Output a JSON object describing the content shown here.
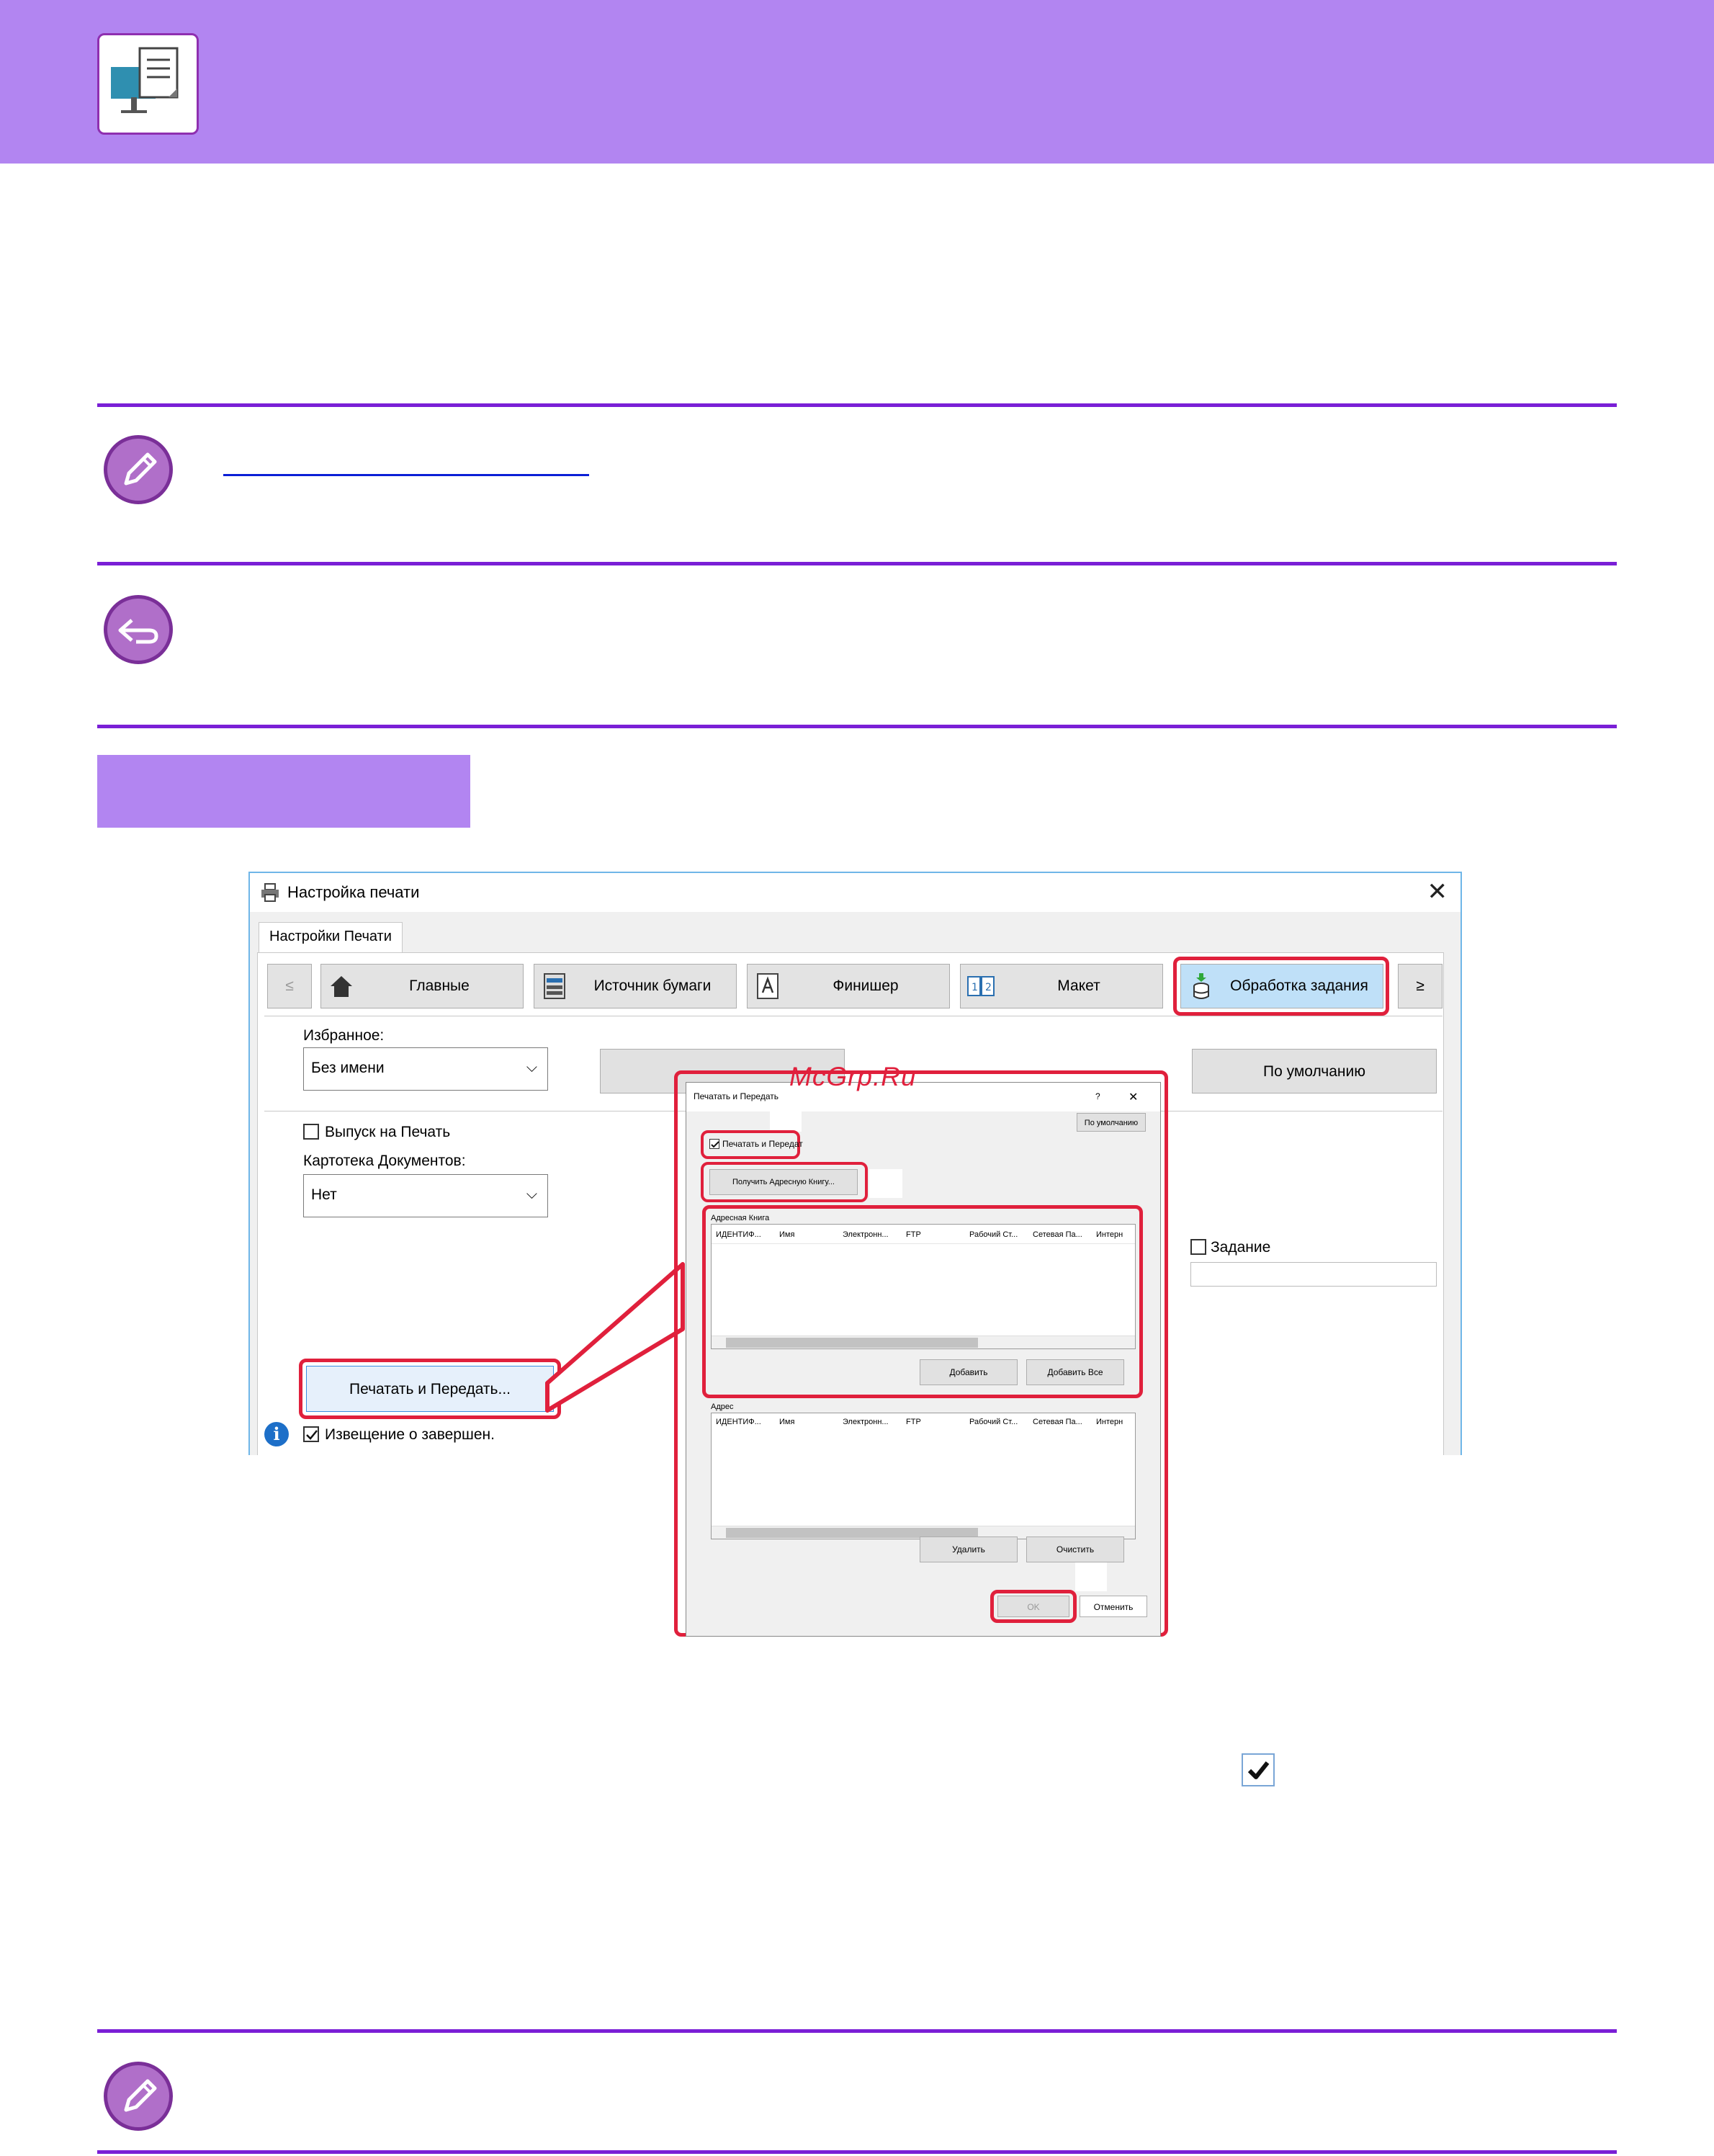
{
  "header": {
    "logo_icon": "print-to-screen-icon"
  },
  "notes": {
    "note_icon": "pencil-icon",
    "back_icon": "return-icon"
  },
  "window": {
    "title": "Настройка печати",
    "tab_label": "Настройки Печати",
    "nav_prev": "≤",
    "nav_next": "≥",
    "tabs": [
      {
        "label": "Главные",
        "icon": "home-icon"
      },
      {
        "label": "Источник бумаги",
        "icon": "paper-tray-icon"
      },
      {
        "label": "Финишер",
        "icon": "finisher-icon"
      },
      {
        "label": "Макет",
        "icon": "layout-icon"
      },
      {
        "label": "Обработка задания",
        "icon": "job-handling-icon"
      }
    ],
    "favorites_label": "Избранное:",
    "favorites_value": "Без имени",
    "default_button": "По умолчанию",
    "hold_print_label": "Выпуск на Печать",
    "doc_filing_label": "Картотека Документов:",
    "doc_filing_value": "Нет",
    "job_label": "Задание",
    "print_send_button": "Печатать и Передать...",
    "notify_label": "Извещение о завершен."
  },
  "watermark": "McGrp.Ru",
  "dialog": {
    "title": "Печатать и Передать",
    "help": "?",
    "close": "✕",
    "default_button": "По умолчанию",
    "print_send_check": "Печатать и Передат",
    "get_address_book": "Получить Адресную Книгу...",
    "address_book_label": "Адресная Книга",
    "address_label": "Адрес",
    "columns": [
      "ИДЕНТИФ...",
      "Имя",
      "Электронн...",
      "FTP",
      "Рабочий Ст...",
      "Сетевая Па...",
      "Интерн"
    ],
    "add": "Добавить",
    "add_all": "Добавить Все",
    "delete": "Удалить",
    "clear": "Очистить",
    "ok": "OK",
    "cancel": "Отменить"
  }
}
